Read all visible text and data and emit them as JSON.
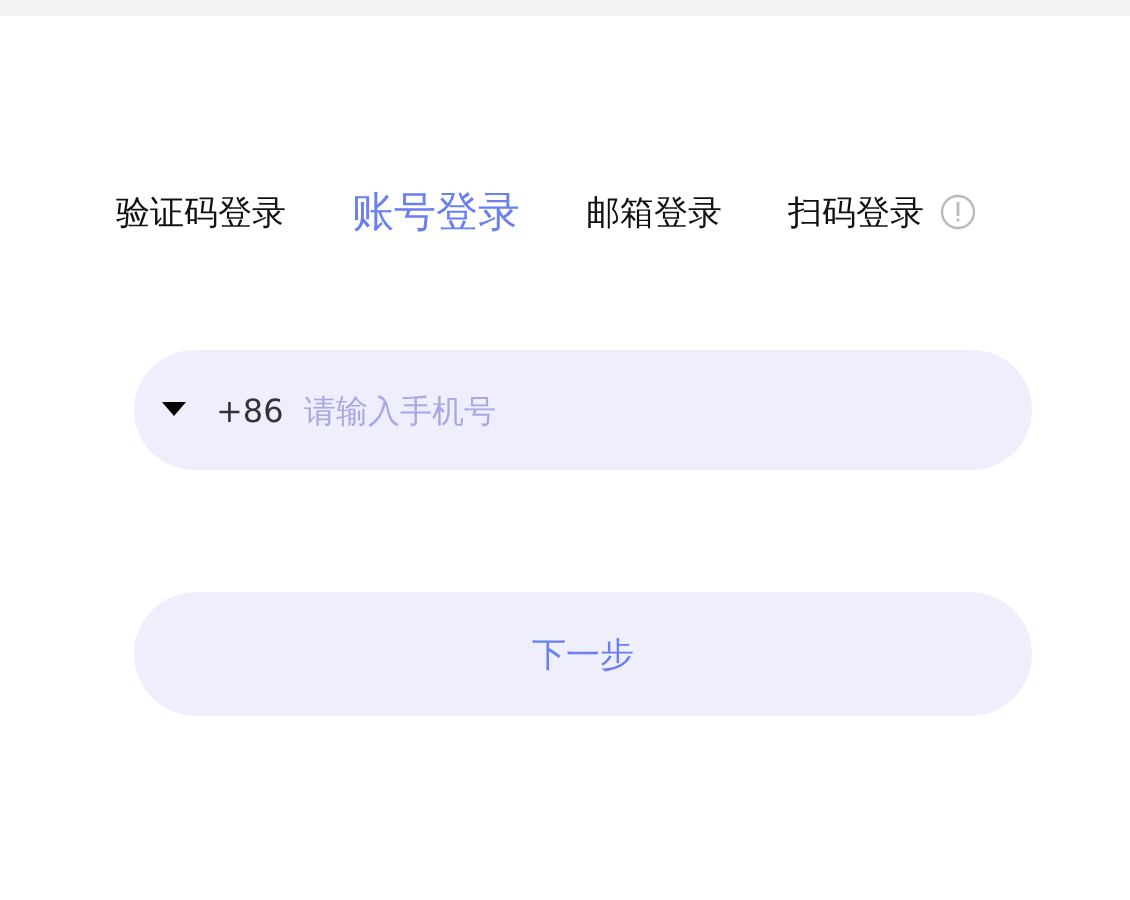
{
  "tabs": [
    {
      "label": "验证码登录",
      "selected": false
    },
    {
      "label": "账号登录",
      "selected": true
    },
    {
      "label": "邮箱登录",
      "selected": false
    },
    {
      "label": "扫码登录",
      "selected": false
    }
  ],
  "phone_field": {
    "country_code": "+86",
    "placeholder": "请输入手机号"
  },
  "next_button": {
    "label": "下一步"
  }
}
